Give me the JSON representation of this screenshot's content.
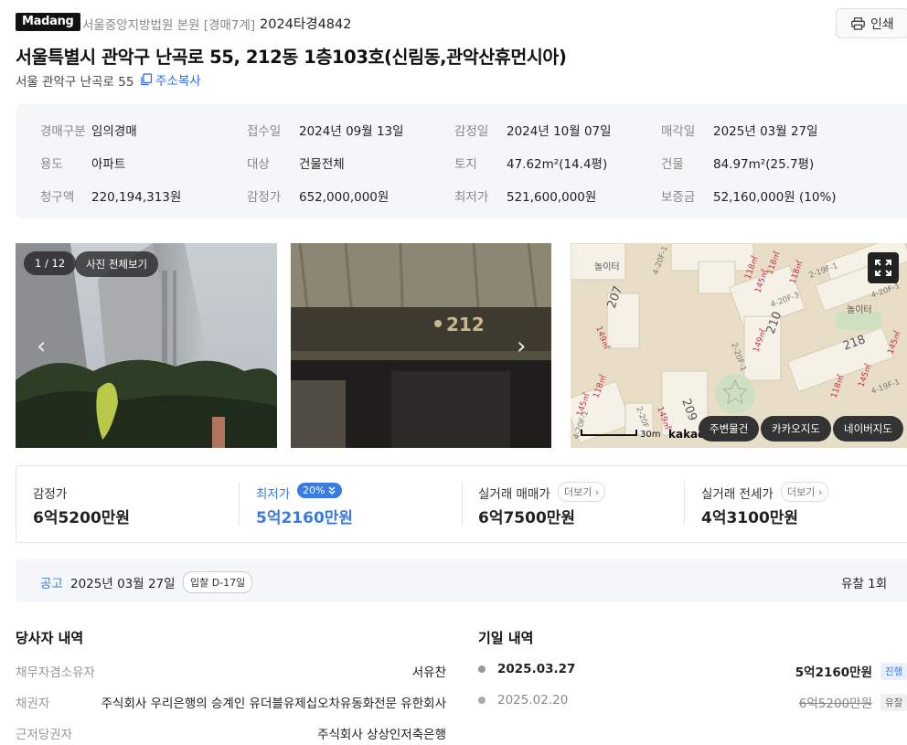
{
  "header": {
    "brand": "Madang",
    "court": "서울중앙지방법원 본원 [경매7계]",
    "case_no": "2024타경4842",
    "print_label": "인쇄"
  },
  "title": "서울특별시 관악구 난곡로 55, 212동 1층103호(신림동,관악산휴먼시아)",
  "address": "서울 관악구 난곡로 55",
  "copy_label": "주소복사",
  "info": [
    [
      {
        "label": "경매구분",
        "value": "임의경매"
      },
      {
        "label": "접수일",
        "value": "2024년 09월 13일"
      },
      {
        "label": "감정일",
        "value": "2024년 10월 07일"
      },
      {
        "label": "매각일",
        "value": "2025년 03월 27일"
      }
    ],
    [
      {
        "label": "용도",
        "value": "아파트"
      },
      {
        "label": "대상",
        "value": "건물전체"
      },
      {
        "label": "토지",
        "value": "47.62m²(14.4평)"
      },
      {
        "label": "건물",
        "value": "84.97m²(25.7평)"
      }
    ],
    [
      {
        "label": "청구액",
        "value": "220,194,313원"
      },
      {
        "label": "감정가",
        "value": "652,000,000원"
      },
      {
        "label": "최저가",
        "value": "521,600,000원"
      },
      {
        "label": "보증금",
        "value": "52,160,000원 (10%)"
      }
    ]
  ],
  "gallery": {
    "counter": "1 / 12",
    "view_all": "사진 전체보기",
    "sign_text": "212"
  },
  "map": {
    "labels": {
      "playground1": "놀이터",
      "playground2": "놀이터",
      "b207": "207",
      "b210": "210",
      "b218": "218",
      "b209": "209",
      "a1": "118㎡",
      "a2": "118㎡",
      "a3": "145㎡",
      "a4": "149㎡",
      "a5": "149㎡",
      "a6": "118㎡",
      "a7": "145㎡",
      "a8": "149㎡",
      "a9": "118㎡",
      "a10": "145㎡",
      "a11": "145㎡",
      "a12": "118㎡",
      "c1": "4-20F-1",
      "c2": "2-19F-1",
      "c3": "4-20F-3",
      "c4": "4-20F-1",
      "c5": "2-20F-1",
      "c6": "4-19F-1",
      "c7": "2-20F",
      "c8": "4-20F-1"
    },
    "scale": "30m",
    "provider": "kakao",
    "buttons": [
      "주변물건",
      "카카오지도",
      "네이버지도"
    ]
  },
  "prices": {
    "appraisal": {
      "label": "감정가",
      "value": "6억5200만원"
    },
    "minimum": {
      "label": "최저가",
      "badge": "20%",
      "value": "5억2160만원"
    },
    "sale": {
      "label": "실거래 매매가",
      "more": "더보기",
      "value": "6억7500만원"
    },
    "jeonse": {
      "label": "실거래 전세가",
      "more": "더보기",
      "value": "4억3100만원"
    }
  },
  "notice": {
    "label": "공고",
    "date": "2025년 03월 27일",
    "badge": "입찰 D-17일",
    "fail": "유찰 1회"
  },
  "parties": {
    "title": "당사자 내역",
    "rows": [
      {
        "label": "채무자겸소유자",
        "value": "서유찬"
      },
      {
        "label": "채권자",
        "value": "주식회사 우리은행의 승계인 유더블유제십오차유동화전문 유한회사"
      },
      {
        "label": "근저당권자",
        "value": "주식회사 상상인저축은행"
      }
    ]
  },
  "schedule": {
    "title": "기일 내역",
    "rows": [
      {
        "date": "2025.03.27",
        "price": "5억2160만원",
        "status": "진행"
      },
      {
        "date": "2025.02.20",
        "price": "6억5200만원",
        "status": "유찰"
      }
    ]
  },
  "colors": {
    "accent": "#3a7be0",
    "badge_bg": "#e8f0fd"
  }
}
